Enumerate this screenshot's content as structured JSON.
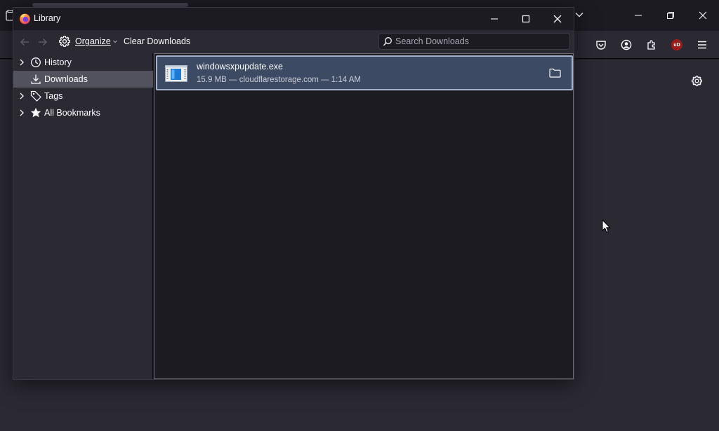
{
  "browser": {
    "window_controls": [
      "minimize",
      "restore",
      "close"
    ],
    "toolbar_icons": [
      "pocket-icon",
      "account-icon",
      "extensions-icon",
      "ublock-icon",
      "menu-icon"
    ],
    "ublock_badge": "uD",
    "settings_icon": "gear-icon"
  },
  "library": {
    "title": "Library",
    "toolbar": {
      "organize_label": "Organize",
      "clear_downloads_label": "Clear Downloads",
      "search_placeholder": "Search Downloads"
    },
    "sidebar": {
      "items": [
        {
          "label": "History",
          "icon": "clock-icon",
          "expandable": true,
          "selected": false
        },
        {
          "label": "Downloads",
          "icon": "download-icon",
          "expandable": false,
          "selected": true
        },
        {
          "label": "Tags",
          "icon": "tag-icon",
          "expandable": true,
          "selected": false
        },
        {
          "label": "All Bookmarks",
          "icon": "star-icon",
          "expandable": true,
          "selected": false
        }
      ]
    },
    "downloads": [
      {
        "filename": "windowsxpupdate.exe",
        "status": "15.9 MB — cloudflarestorage.com — 1:14 AM",
        "icon": "exe-file-icon",
        "action_icon": "open-folder-icon"
      }
    ]
  },
  "colors": {
    "background": "#1c1b22",
    "panel": "#2b2a33",
    "selection": "#3c4b63",
    "accent_border": "#a4b3c9"
  }
}
